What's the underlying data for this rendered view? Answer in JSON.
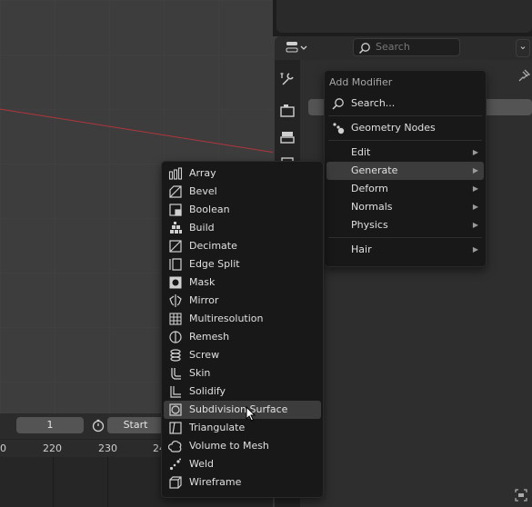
{
  "properties": {
    "search_placeholder": "Search"
  },
  "timeline": {
    "current_frame": "1",
    "start_label": "Start",
    "ruler_labels": [
      "0",
      "220",
      "230",
      "24"
    ]
  },
  "add_modifier_menu": {
    "title": "Add Modifier",
    "search_label": "Search...",
    "geometry_nodes_label": "Geometry Nodes",
    "categories": [
      {
        "label": "Edit"
      },
      {
        "label": "Generate"
      },
      {
        "label": "Deform"
      },
      {
        "label": "Normals"
      },
      {
        "label": "Physics"
      }
    ],
    "hair_label": "Hair"
  },
  "generate_submenu": {
    "items": [
      {
        "label": "Array",
        "icon": "array-icon"
      },
      {
        "label": "Bevel",
        "icon": "bevel-icon"
      },
      {
        "label": "Boolean",
        "icon": "boolean-icon"
      },
      {
        "label": "Build",
        "icon": "build-icon"
      },
      {
        "label": "Decimate",
        "icon": "decimate-icon"
      },
      {
        "label": "Edge Split",
        "icon": "edge-split-icon"
      },
      {
        "label": "Mask",
        "icon": "mask-icon"
      },
      {
        "label": "Mirror",
        "icon": "mirror-icon"
      },
      {
        "label": "Multiresolution",
        "icon": "multiresolution-icon"
      },
      {
        "label": "Remesh",
        "icon": "remesh-icon"
      },
      {
        "label": "Screw",
        "icon": "screw-icon"
      },
      {
        "label": "Skin",
        "icon": "skin-icon"
      },
      {
        "label": "Solidify",
        "icon": "solidify-icon"
      },
      {
        "label": "Subdivision Surface",
        "icon": "subdivision-surface-icon"
      },
      {
        "label": "Triangulate",
        "icon": "triangulate-icon"
      },
      {
        "label": "Volume to Mesh",
        "icon": "volume-to-mesh-icon"
      },
      {
        "label": "Weld",
        "icon": "weld-icon"
      },
      {
        "label": "Wireframe",
        "icon": "wireframe-icon"
      }
    ],
    "highlighted": "Subdivision Surface"
  },
  "colors": {
    "menu_bg": "#181818",
    "highlight": "#3c3c3c",
    "x_axis": "#b2363c"
  }
}
